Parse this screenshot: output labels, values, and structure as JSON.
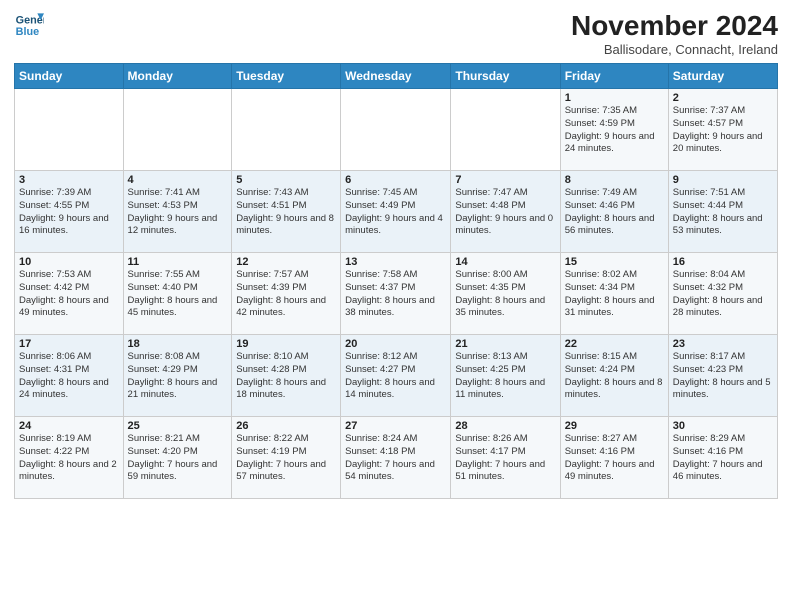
{
  "logo": {
    "line1": "General",
    "line2": "Blue"
  },
  "title": "November 2024",
  "location": "Ballisodare, Connacht, Ireland",
  "headers": [
    "Sunday",
    "Monday",
    "Tuesday",
    "Wednesday",
    "Thursday",
    "Friday",
    "Saturday"
  ],
  "weeks": [
    [
      {
        "day": "",
        "info": ""
      },
      {
        "day": "",
        "info": ""
      },
      {
        "day": "",
        "info": ""
      },
      {
        "day": "",
        "info": ""
      },
      {
        "day": "",
        "info": ""
      },
      {
        "day": "1",
        "info": "Sunrise: 7:35 AM\nSunset: 4:59 PM\nDaylight: 9 hours and 24 minutes."
      },
      {
        "day": "2",
        "info": "Sunrise: 7:37 AM\nSunset: 4:57 PM\nDaylight: 9 hours and 20 minutes."
      }
    ],
    [
      {
        "day": "3",
        "info": "Sunrise: 7:39 AM\nSunset: 4:55 PM\nDaylight: 9 hours and 16 minutes."
      },
      {
        "day": "4",
        "info": "Sunrise: 7:41 AM\nSunset: 4:53 PM\nDaylight: 9 hours and 12 minutes."
      },
      {
        "day": "5",
        "info": "Sunrise: 7:43 AM\nSunset: 4:51 PM\nDaylight: 9 hours and 8 minutes."
      },
      {
        "day": "6",
        "info": "Sunrise: 7:45 AM\nSunset: 4:49 PM\nDaylight: 9 hours and 4 minutes."
      },
      {
        "day": "7",
        "info": "Sunrise: 7:47 AM\nSunset: 4:48 PM\nDaylight: 9 hours and 0 minutes."
      },
      {
        "day": "8",
        "info": "Sunrise: 7:49 AM\nSunset: 4:46 PM\nDaylight: 8 hours and 56 minutes."
      },
      {
        "day": "9",
        "info": "Sunrise: 7:51 AM\nSunset: 4:44 PM\nDaylight: 8 hours and 53 minutes."
      }
    ],
    [
      {
        "day": "10",
        "info": "Sunrise: 7:53 AM\nSunset: 4:42 PM\nDaylight: 8 hours and 49 minutes."
      },
      {
        "day": "11",
        "info": "Sunrise: 7:55 AM\nSunset: 4:40 PM\nDaylight: 8 hours and 45 minutes."
      },
      {
        "day": "12",
        "info": "Sunrise: 7:57 AM\nSunset: 4:39 PM\nDaylight: 8 hours and 42 minutes."
      },
      {
        "day": "13",
        "info": "Sunrise: 7:58 AM\nSunset: 4:37 PM\nDaylight: 8 hours and 38 minutes."
      },
      {
        "day": "14",
        "info": "Sunrise: 8:00 AM\nSunset: 4:35 PM\nDaylight: 8 hours and 35 minutes."
      },
      {
        "day": "15",
        "info": "Sunrise: 8:02 AM\nSunset: 4:34 PM\nDaylight: 8 hours and 31 minutes."
      },
      {
        "day": "16",
        "info": "Sunrise: 8:04 AM\nSunset: 4:32 PM\nDaylight: 8 hours and 28 minutes."
      }
    ],
    [
      {
        "day": "17",
        "info": "Sunrise: 8:06 AM\nSunset: 4:31 PM\nDaylight: 8 hours and 24 minutes."
      },
      {
        "day": "18",
        "info": "Sunrise: 8:08 AM\nSunset: 4:29 PM\nDaylight: 8 hours and 21 minutes."
      },
      {
        "day": "19",
        "info": "Sunrise: 8:10 AM\nSunset: 4:28 PM\nDaylight: 8 hours and 18 minutes."
      },
      {
        "day": "20",
        "info": "Sunrise: 8:12 AM\nSunset: 4:27 PM\nDaylight: 8 hours and 14 minutes."
      },
      {
        "day": "21",
        "info": "Sunrise: 8:13 AM\nSunset: 4:25 PM\nDaylight: 8 hours and 11 minutes."
      },
      {
        "day": "22",
        "info": "Sunrise: 8:15 AM\nSunset: 4:24 PM\nDaylight: 8 hours and 8 minutes."
      },
      {
        "day": "23",
        "info": "Sunrise: 8:17 AM\nSunset: 4:23 PM\nDaylight: 8 hours and 5 minutes."
      }
    ],
    [
      {
        "day": "24",
        "info": "Sunrise: 8:19 AM\nSunset: 4:22 PM\nDaylight: 8 hours and 2 minutes."
      },
      {
        "day": "25",
        "info": "Sunrise: 8:21 AM\nSunset: 4:20 PM\nDaylight: 7 hours and 59 minutes."
      },
      {
        "day": "26",
        "info": "Sunrise: 8:22 AM\nSunset: 4:19 PM\nDaylight: 7 hours and 57 minutes."
      },
      {
        "day": "27",
        "info": "Sunrise: 8:24 AM\nSunset: 4:18 PM\nDaylight: 7 hours and 54 minutes."
      },
      {
        "day": "28",
        "info": "Sunrise: 8:26 AM\nSunset: 4:17 PM\nDaylight: 7 hours and 51 minutes."
      },
      {
        "day": "29",
        "info": "Sunrise: 8:27 AM\nSunset: 4:16 PM\nDaylight: 7 hours and 49 minutes."
      },
      {
        "day": "30",
        "info": "Sunrise: 8:29 AM\nSunset: 4:16 PM\nDaylight: 7 hours and 46 minutes."
      }
    ]
  ]
}
